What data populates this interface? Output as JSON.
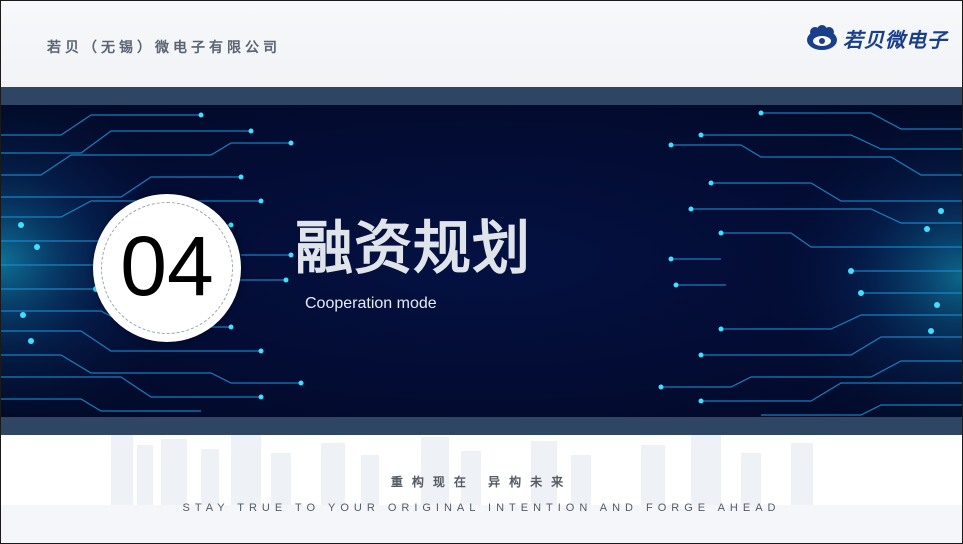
{
  "header": {
    "company_name": "若贝（无锡）微电子有限公司",
    "logo_text": "若贝微电子",
    "logo_icon": "flower-logo-icon"
  },
  "banner": {
    "section_number": "04",
    "title": "融资规划",
    "subtitle": "Cooperation mode"
  },
  "footer": {
    "slogan_cn": "重构现在   异构未来",
    "slogan_en": "STAY TRUE TO YOUR ORIGINAL INTENTION AND FORGE AHEAD"
  },
  "colors": {
    "band": "#2e4563",
    "banner_bg": "#030c33",
    "circuit_glow": "#1ec8ff",
    "logo_blue": "#1a3f8a",
    "text_gray": "#555b63"
  }
}
